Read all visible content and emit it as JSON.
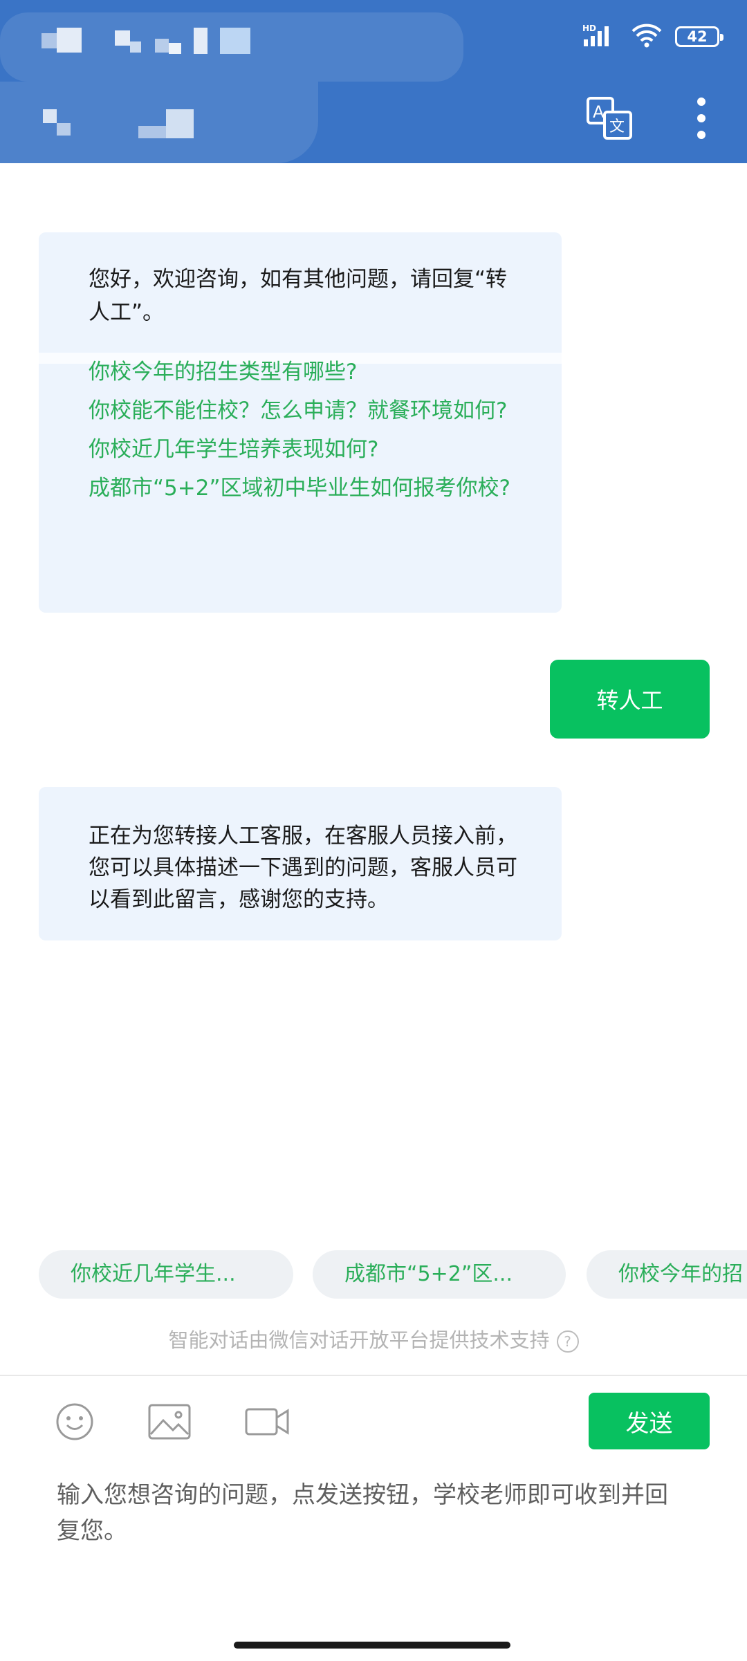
{
  "status_bar": {
    "network_label": "HD",
    "battery_level": "42",
    "icons": [
      "cellular-signal-icon",
      "wifi-icon",
      "battery-icon"
    ]
  },
  "header": {
    "actions": [
      "translate-icon",
      "more-vertical-icon"
    ]
  },
  "messages": [
    {
      "side": "left",
      "text": "您好，欢迎咨询，如有其他问题，请回复“转人工”。",
      "links": [
        "你校今年的招生类型有哪些?",
        "你校能不能住校？怎么申请？就餐环境如何?",
        "你校近几年学生培养表现如何?",
        "成都市“5+2”区域初中毕业生如何报考你校?"
      ]
    },
    {
      "side": "right",
      "text": "转人工"
    },
    {
      "side": "left",
      "text": "正在为您转接人工客服，在客服人员接入前，您可以具体描述一下遇到的问题，客服人员可以看到此留言，感谢您的支持。"
    }
  ],
  "quick_replies": [
    "你校近几年学生...",
    "成都市“5+2”区...",
    "你校今年的招"
  ],
  "footer_note": "智能对话由微信对话开放平台提供技术支持",
  "composer": {
    "tools": [
      "emoji-icon",
      "image-icon",
      "video-icon"
    ],
    "send_label": "发送",
    "placeholder": "输入您想咨询的问题，点发送按钮，学校老师即可收到并回复您。"
  },
  "colors": {
    "header": "#3a74c6",
    "accent_green": "#08c160",
    "link_green": "#2aae59",
    "bubble_bg": "#edf4fd"
  }
}
